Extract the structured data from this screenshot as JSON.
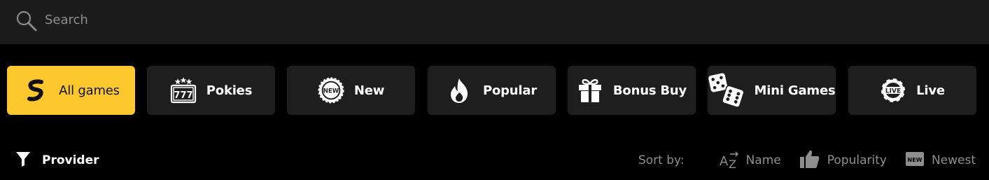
{
  "search": {
    "placeholder": "Search",
    "icon": "search-icon"
  },
  "categories": [
    {
      "label": "All games",
      "icon": "all-games-icon",
      "active": true
    },
    {
      "label": "Pokies",
      "icon": "slot-machine-icon",
      "active": false
    },
    {
      "label": "New",
      "icon": "new-badge-icon",
      "active": false
    },
    {
      "label": "Popular",
      "icon": "flame-icon",
      "active": false
    },
    {
      "label": "Bonus Buy",
      "icon": "gift-icon",
      "active": false
    },
    {
      "label": "Mini Games",
      "icon": "dice-icon",
      "active": false
    },
    {
      "label": "Live",
      "icon": "live-chip-icon",
      "active": false
    }
  ],
  "filter": {
    "provider_label": "Provider",
    "icon": "filter-funnel-icon"
  },
  "sort": {
    "label": "Sort by:",
    "options": [
      {
        "label": "Name",
        "icon": "az-sort-icon"
      },
      {
        "label": "Popularity",
        "icon": "thumbs-up-icon"
      },
      {
        "label": "Newest",
        "icon": "new-tag-icon"
      }
    ]
  },
  "colors": {
    "accent": "#fcc82d",
    "tile": "#1e1e1f",
    "searchbar": "#1c1c1c",
    "muted": "#8e8e8e"
  }
}
